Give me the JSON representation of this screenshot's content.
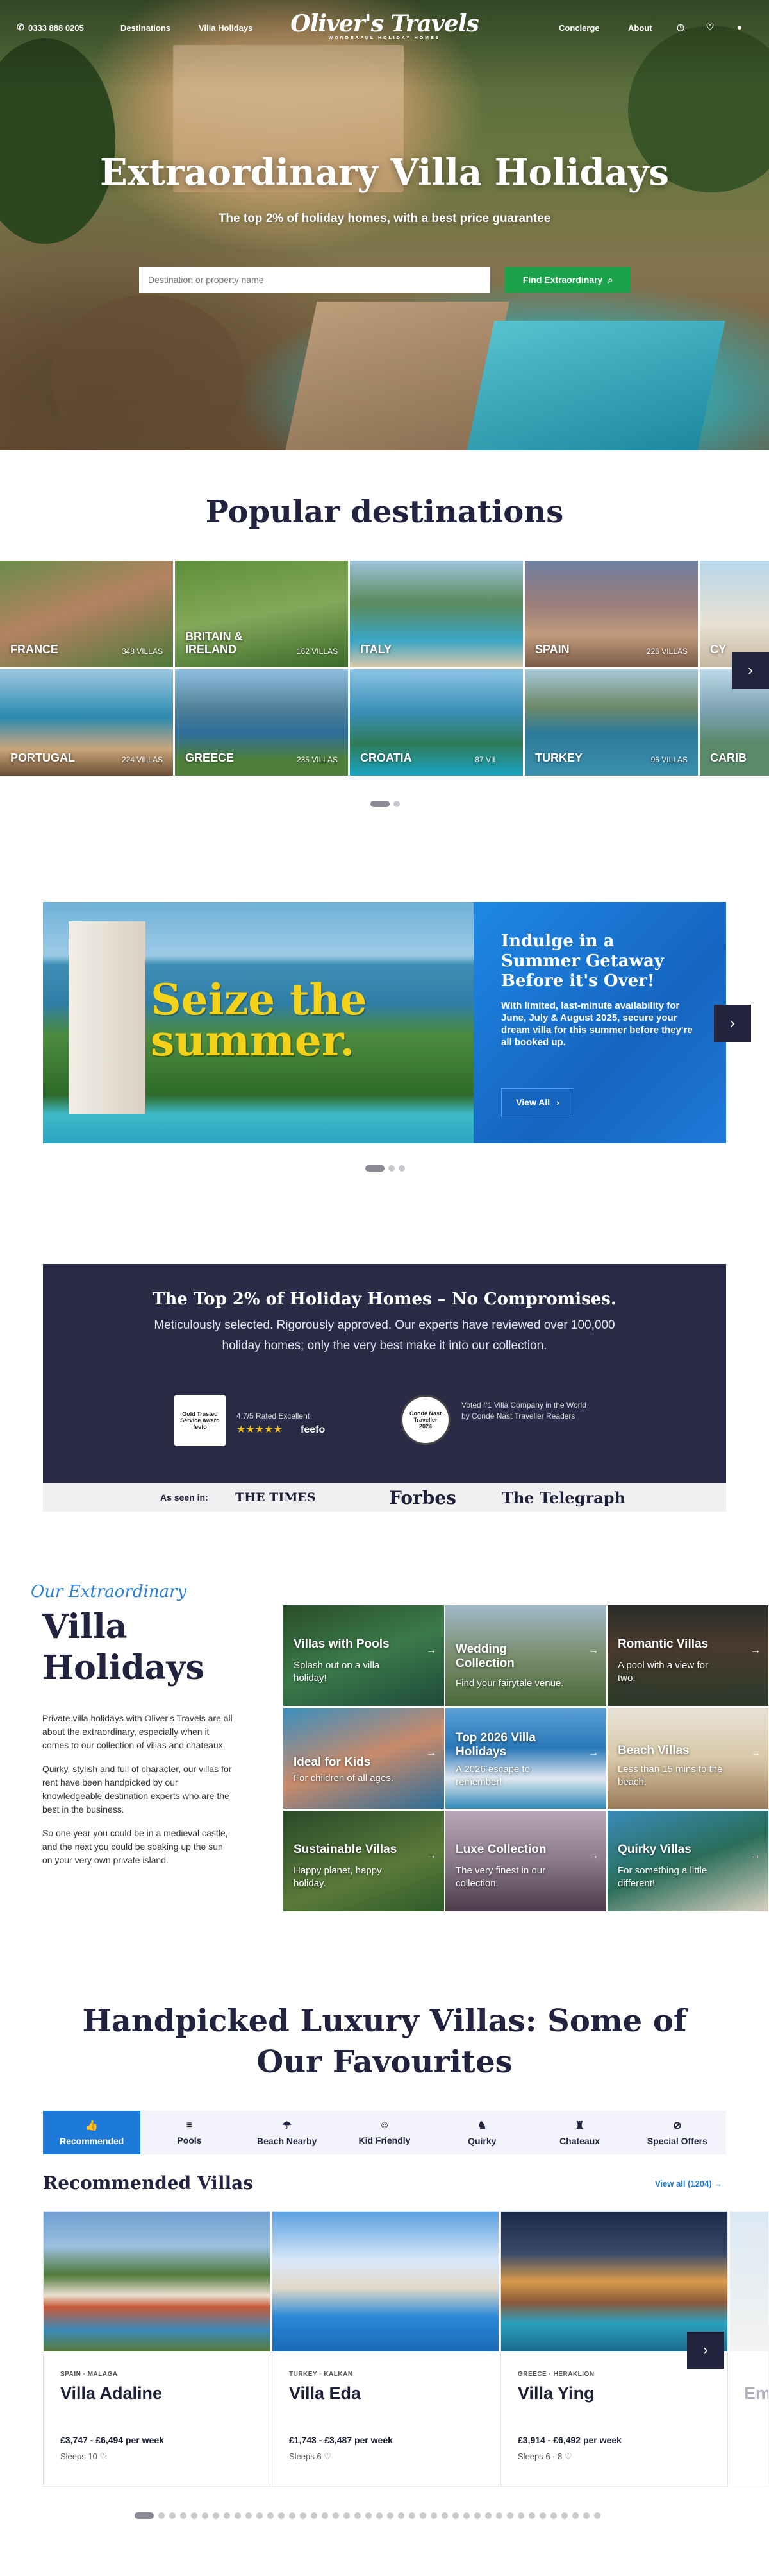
{
  "header": {
    "phone": "0333 888 0205",
    "nav_left": [
      "Destinations",
      "Villa Holidays"
    ],
    "logo_name": "Oliver's Travels",
    "logo_sub": "WONDERFUL HOLIDAY HOMES",
    "nav_right": [
      "Concierge",
      "About"
    ],
    "icons": [
      "phone-icon",
      "clock-icon",
      "heart-icon",
      "user-icon"
    ]
  },
  "hero": {
    "title": "Extraordinary Villa Holidays",
    "subtitle": "The top 2% of holiday homes, with a best price guarantee",
    "search_placeholder": "Destination or property name",
    "search_button": "Find Extraordinary"
  },
  "popular": {
    "title": "Popular destinations",
    "items": [
      {
        "label": "FRANCE",
        "count": "348 VILLAS"
      },
      {
        "label": "BRITAIN & IRELAND",
        "count": "162 VILLAS"
      },
      {
        "label": "ITALY",
        "count": ""
      },
      {
        "label": "SPAIN",
        "count": "226 VILLAS"
      },
      {
        "label": "CY",
        "count": ""
      },
      {
        "label": "PORTUGAL",
        "count": "224 VILLAS"
      },
      {
        "label": "GREECE",
        "count": "235 VILLAS"
      },
      {
        "label": "CROATIA",
        "count": "87 VIL"
      },
      {
        "label": "TURKEY",
        "count": "96 VILLAS"
      },
      {
        "label": "CARIB",
        "count": ""
      }
    ]
  },
  "banner": {
    "headline": "Seize the summer.",
    "panel_title": "Indulge in a Summer Getaway Before it's Over!",
    "panel_text": "With limited, last-minute availability for June, July & August 2025, secure your dream villa for this summer before they're all booked up.",
    "cta": "View All"
  },
  "top2": {
    "title": "The Top 2% of Holiday Homes – No Compromises.",
    "text": "Meticulously selected. Rigorously approved. Our experts have reviewed over 100,000 holiday homes; only the very best make it into our collection.",
    "feefo_rating": "4.7/5 Rated Excellent",
    "feefo_badge": "Gold Trusted Service Award feefo",
    "feefo_logo": "feefo",
    "stars": "★★★★★",
    "cn_badge": "Condé Nast Traveller 2024",
    "cn_text": "Voted #1 Villa Company in the World by Condé Nast Traveller Readers",
    "seen_label": "As seen in:",
    "press": [
      "THE TIMES",
      "Forbes",
      "The Telegraph"
    ]
  },
  "villa_holidays": {
    "script": "Our Extraordinary",
    "title": "Villa Holidays",
    "paragraphs": [
      "Private villa holidays with Oliver's Travels are all about the extraordinary, especially when it comes to our collection of villas and chateaux.",
      "Quirky, stylish and full of character, our villas for rent have been handpicked by our knowledgeable destination experts who are the best in the business.",
      "So one year you could be in a medieval castle, and the next you could be soaking up the sun on your very own private island."
    ],
    "categories": [
      {
        "title": "Villas with Pools",
        "sub": "Splash out on a villa holiday!"
      },
      {
        "title": "Wedding Collection",
        "sub": "Find your fairytale venue."
      },
      {
        "title": "Romantic Villas",
        "sub": "A pool with a view for two."
      },
      {
        "title": "Ideal for Kids",
        "sub": "For children of all ages."
      },
      {
        "title": "Top 2026 Villa Holidays",
        "sub": "A 2026 escape to remember!"
      },
      {
        "title": "Beach Villas",
        "sub": "Less than 15 mins to the beach."
      },
      {
        "title": "Sustainable Villas",
        "sub": "Happy planet, happy holiday."
      },
      {
        "title": "Luxe Collection",
        "sub": "The very finest in our collection."
      },
      {
        "title": "Quirky Villas",
        "sub": "For something a little different!"
      }
    ]
  },
  "handpicked": {
    "title": "Handpicked Luxury Villas: Some of Our Favourites",
    "tabs": [
      {
        "label": "Recommended",
        "icon": "thumbs-up-icon"
      },
      {
        "label": "Pools",
        "icon": "pool-ladder-icon"
      },
      {
        "label": "Beach Nearby",
        "icon": "umbrella-icon"
      },
      {
        "label": "Kid Friendly",
        "icon": "smile-icon"
      },
      {
        "label": "Quirky",
        "icon": "unicorn-icon"
      },
      {
        "label": "Chateaux",
        "icon": "castle-icon"
      },
      {
        "label": "Special Offers",
        "icon": "tag-icon"
      }
    ],
    "section_title": "Recommended Villas",
    "view_all": "View all (1204)",
    "villas": [
      {
        "location": "SPAIN · MALAGA",
        "name": "Villa Adaline",
        "price": "£3,747 - £6,494 per week",
        "sleeps": "Sleeps 10"
      },
      {
        "location": "TURKEY · KALKAN",
        "name": "Villa Eda",
        "price": "£1,743 - £3,487 per week",
        "sleeps": "Sleeps 6"
      },
      {
        "location": "GREECE · HERAKLION",
        "name": "Villa Ying",
        "price": "£3,914 - £6,492 per week",
        "sleeps": "Sleeps 6 - 8"
      },
      {
        "location": "",
        "name": "Em",
        "price": "",
        "sleeps": ""
      }
    ]
  }
}
